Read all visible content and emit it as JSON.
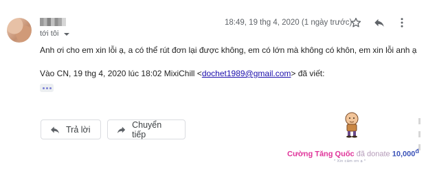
{
  "email": {
    "recipient_label": "tới tôi",
    "timestamp": "18:49, 19 thg 4, 2020 (1 ngày trước)",
    "body": "Anh ơi cho em xin lỗi ạ, a có thể rút đơn lại được không, em có lớn mà không có khôn, em xin lỗi anh ạ",
    "quote": {
      "prefix": "Vào CN, 19 thg 4, 2020 lúc 18:02 MixiChill <",
      "email": "dochet1989@gmail.com",
      "suffix": "> đã viết:"
    }
  },
  "actions": {
    "reply_label": "Trả lời",
    "forward_label": "Chuyển tiếp"
  },
  "icons": {
    "star": "star-icon",
    "reply": "reply-icon",
    "more": "more-vert-icon",
    "expand": "expand-quoted-icon"
  },
  "donation": {
    "name": "Cường Tăng Quốc",
    "action": "đã donate",
    "amount": "10,000",
    "currency": "đ",
    "sub": "* Xin cảm ơn ạ *"
  },
  "colors": {
    "link": "#1a0dab",
    "donate_name": "#e0349a",
    "donate_amount": "#3a52b8"
  }
}
